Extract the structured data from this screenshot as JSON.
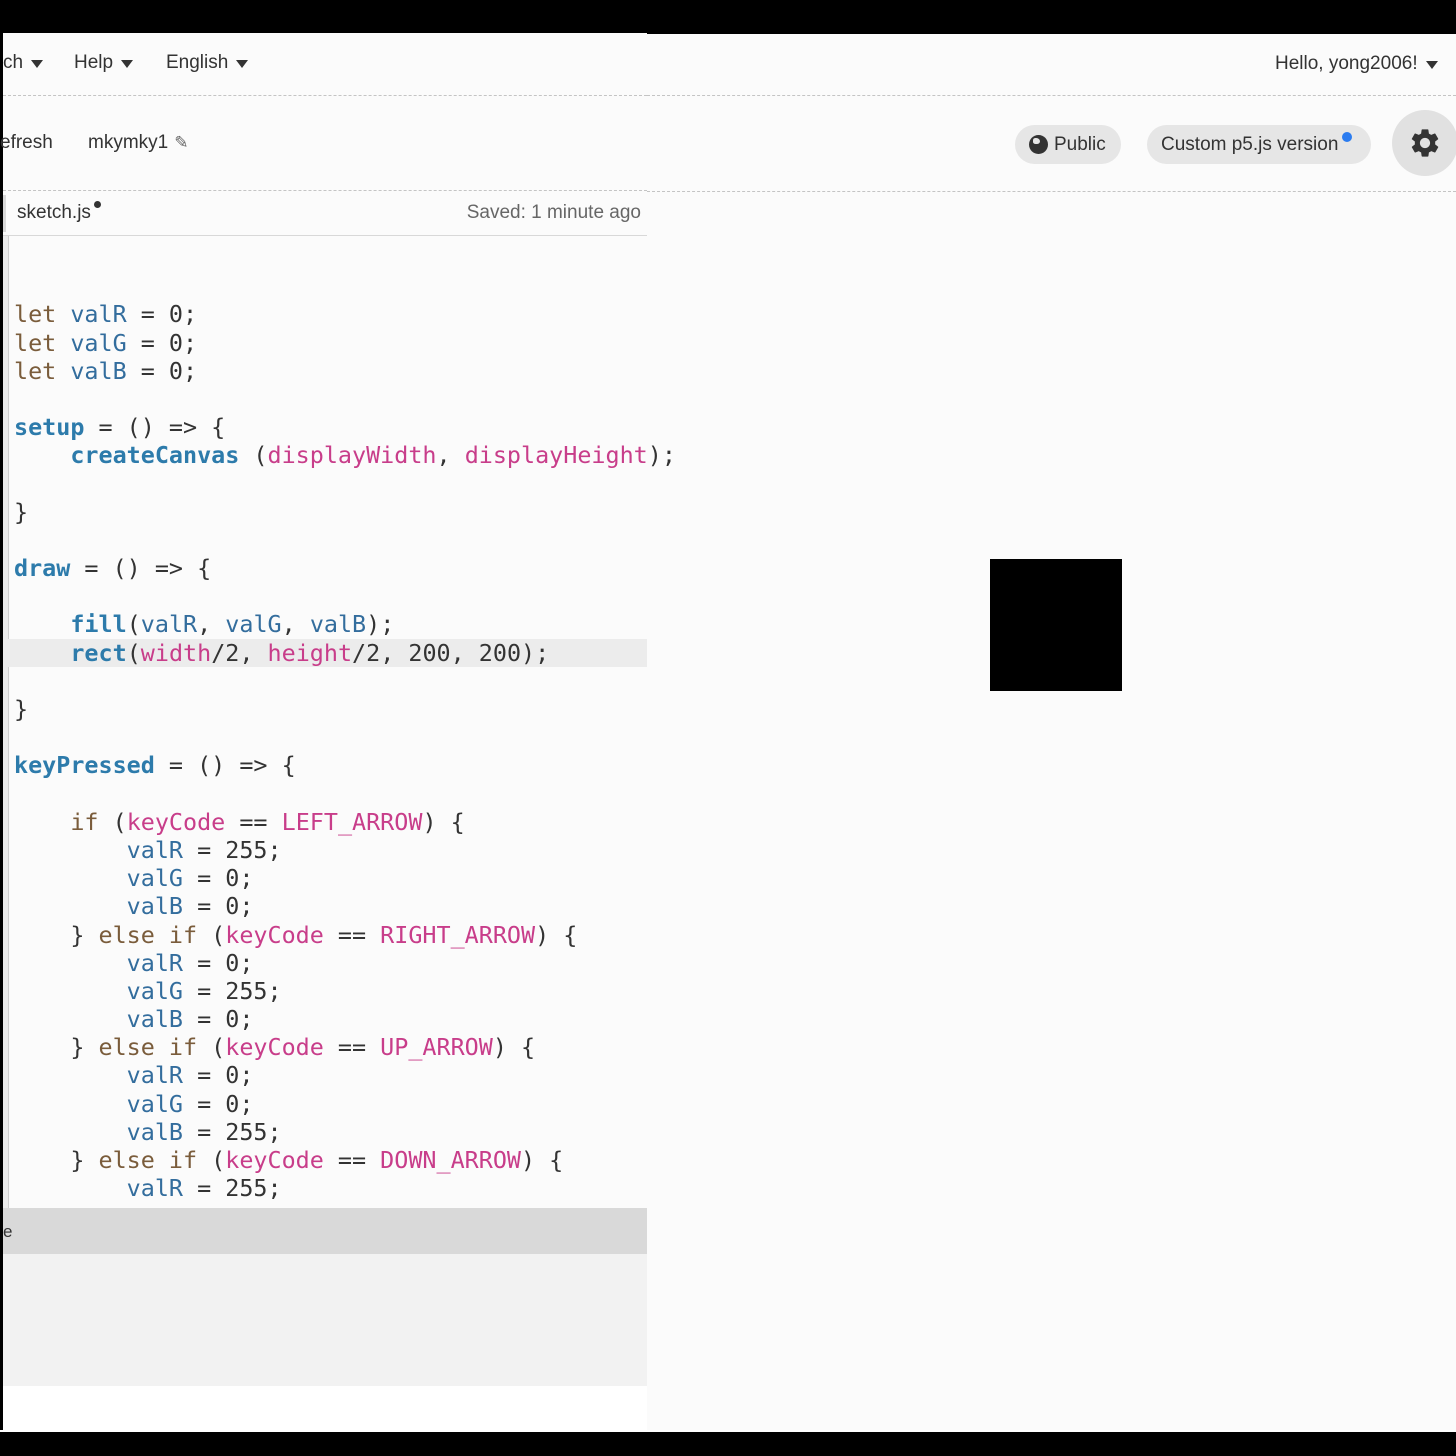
{
  "nav": {
    "menu": [
      {
        "label": "ch"
      },
      {
        "label": "Help"
      },
      {
        "label": "English"
      }
    ],
    "greeting": "Hello, yong2006!"
  },
  "toolbar": {
    "refresh_label": "efresh",
    "sketch_name": "mkymky1",
    "public_label": "Public",
    "p5_version_label": "Custom p5.js version"
  },
  "editor": {
    "file_tab": "sketch.js",
    "saved_status": "Saved: 1 minute ago"
  },
  "code": [
    [],
    [],
    [
      [
        "kw",
        "let"
      ],
      [
        "t",
        " "
      ],
      [
        "var",
        "valR"
      ],
      [
        "t",
        " = 0;"
      ]
    ],
    [
      [
        "kw",
        "let"
      ],
      [
        "t",
        " "
      ],
      [
        "var",
        "valG"
      ],
      [
        "t",
        " = 0;"
      ]
    ],
    [
      [
        "kw",
        "let"
      ],
      [
        "t",
        " "
      ],
      [
        "var",
        "valB"
      ],
      [
        "t",
        " = 0;"
      ]
    ],
    [],
    [
      [
        "fn",
        "setup"
      ],
      [
        "t",
        " = () => {"
      ]
    ],
    [
      [
        "t",
        "    "
      ],
      [
        "fn",
        "createCanvas"
      ],
      [
        "t",
        " ("
      ],
      [
        "prop",
        "displayWidth"
      ],
      [
        "t",
        ", "
      ],
      [
        "prop",
        "displayHeight"
      ],
      [
        "t",
        ");"
      ]
    ],
    [],
    [
      [
        "t",
        "}"
      ]
    ],
    [],
    [
      [
        "fn",
        "draw"
      ],
      [
        "t",
        " = () => {"
      ]
    ],
    [],
    [
      [
        "t",
        "    "
      ],
      [
        "fn",
        "fill"
      ],
      [
        "t",
        "("
      ],
      [
        "var",
        "valR"
      ],
      [
        "t",
        ", "
      ],
      [
        "var",
        "valG"
      ],
      [
        "t",
        ", "
      ],
      [
        "var",
        "valB"
      ],
      [
        "t",
        ");"
      ]
    ],
    [
      [
        "t",
        "    "
      ],
      [
        "fn",
        "rect"
      ],
      [
        "t",
        "("
      ],
      [
        "prop",
        "width"
      ],
      [
        "t",
        "/2, "
      ],
      [
        "prop",
        "height"
      ],
      [
        "t",
        "/2, 200, 200);"
      ]
    ],
    [],
    [
      [
        "t",
        "}"
      ]
    ],
    [],
    [
      [
        "fn",
        "keyPressed"
      ],
      [
        "t",
        " = () => {"
      ]
    ],
    [],
    [
      [
        "t",
        "    "
      ],
      [
        "kw",
        "if"
      ],
      [
        "t",
        " ("
      ],
      [
        "prop",
        "keyCode"
      ],
      [
        "t",
        " == "
      ],
      [
        "prop",
        "LEFT_ARROW"
      ],
      [
        "t",
        ") {"
      ]
    ],
    [
      [
        "t",
        "        "
      ],
      [
        "var",
        "valR"
      ],
      [
        "t",
        " = 255;"
      ]
    ],
    [
      [
        "t",
        "        "
      ],
      [
        "var",
        "valG"
      ],
      [
        "t",
        " = 0;"
      ]
    ],
    [
      [
        "t",
        "        "
      ],
      [
        "var",
        "valB"
      ],
      [
        "t",
        " = 0;"
      ]
    ],
    [
      [
        "t",
        "    } "
      ],
      [
        "kw",
        "else if"
      ],
      [
        "t",
        " ("
      ],
      [
        "prop",
        "keyCode"
      ],
      [
        "t",
        " == "
      ],
      [
        "prop",
        "RIGHT_ARROW"
      ],
      [
        "t",
        ") {"
      ]
    ],
    [
      [
        "t",
        "        "
      ],
      [
        "var",
        "valR"
      ],
      [
        "t",
        " = 0;"
      ]
    ],
    [
      [
        "t",
        "        "
      ],
      [
        "var",
        "valG"
      ],
      [
        "t",
        " = 255;"
      ]
    ],
    [
      [
        "t",
        "        "
      ],
      [
        "var",
        "valB"
      ],
      [
        "t",
        " = 0;"
      ]
    ],
    [
      [
        "t",
        "    } "
      ],
      [
        "kw",
        "else if"
      ],
      [
        "t",
        " ("
      ],
      [
        "prop",
        "keyCode"
      ],
      [
        "t",
        " == "
      ],
      [
        "prop",
        "UP_ARROW"
      ],
      [
        "t",
        ") {"
      ]
    ],
    [
      [
        "t",
        "        "
      ],
      [
        "var",
        "valR"
      ],
      [
        "t",
        " = 0;"
      ]
    ],
    [
      [
        "t",
        "        "
      ],
      [
        "var",
        "valG"
      ],
      [
        "t",
        " = 0;"
      ]
    ],
    [
      [
        "t",
        "        "
      ],
      [
        "var",
        "valB"
      ],
      [
        "t",
        " = 255;"
      ]
    ],
    [
      [
        "t",
        "    } "
      ],
      [
        "kw",
        "else if"
      ],
      [
        "t",
        " ("
      ],
      [
        "prop",
        "keyCode"
      ],
      [
        "t",
        " == "
      ],
      [
        "prop",
        "DOWN_ARROW"
      ],
      [
        "t",
        ") {"
      ]
    ],
    [
      [
        "t",
        "        "
      ],
      [
        "var",
        "valR"
      ],
      [
        "t",
        " = 255;"
      ]
    ]
  ],
  "console": {
    "label": "e"
  },
  "colors": {
    "accent_dot": "#2b7cf0",
    "keyword": "#7a5c3b",
    "function": "#2d7bab",
    "variable": "#336d9d",
    "property": "#c83d8a"
  },
  "icons": {
    "globe": "globe-icon",
    "settings": "gear-icon",
    "edit": "pencil-icon",
    "dropdown": "caret-down-icon"
  }
}
